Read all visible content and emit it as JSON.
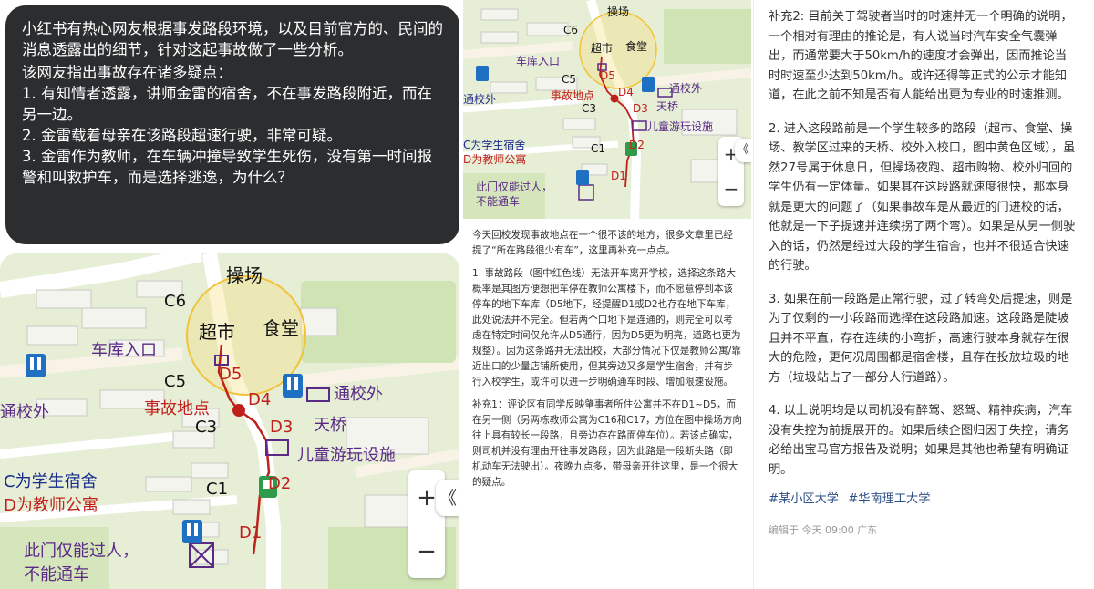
{
  "bubble": {
    "para1": "小红书有热心网友根据事发路段环境，以及目前官方的、民间的消息透露出的细节，针对这起事故做了一些分析。",
    "para2": "该网友指出事故存在诸多疑点：",
    "item1": "1. 有知情者透露，讲师金雷的宿舍，不在事发路段附近，而在另一边。",
    "item2": "2. 金雷载着母亲在该路段超速行驶，非常可疑。",
    "item3": "3. 金雷作为教师，在车辆冲撞导致学生死伤，没有第一时间报警和叫救护车，而是选择逃逸，为什么？"
  },
  "map": {
    "playground": "操场",
    "c6": "C6",
    "supermarket": "超市",
    "canteen": "食堂",
    "garage_entrance": "车库入口",
    "d5": "D5",
    "to_outside_left": "通校外",
    "c5": "C5",
    "accident_site": "事故地点",
    "d4": "D4",
    "to_outside_right": "通校外",
    "overpass": "天桥",
    "c3": "C3",
    "d3": "D3",
    "playground_facility": "儿童游玩设施",
    "legend_c": "C为学生宿舍",
    "legend_d": "D为教师公寓",
    "c1": "C1",
    "d2": "D2",
    "d1": "D1",
    "gate_note_line1": "此门仅能过人，",
    "gate_note_line2": "不能通车",
    "zoom_in": "+",
    "zoom_out": "−",
    "expand": "《",
    "colors": {
      "route": "#c0201b",
      "circle": "#f1c33a",
      "blue_sign": "#1f6fc2",
      "green_sign": "#2f9a4a"
    }
  },
  "middle": {
    "intro": "今天回校发现事故地点在一个很不该的地方，很多文章里已经提了“所在路段很少有车”，这里再补充一点点。",
    "p1": "1. 事故路段（图中红色线）无法开车离开学校，选择这条路大概率是其图方便想把车停在教师公寓楼下，而不愿意停到本该停车的地下车库（D5地下，经提醒D1或D2也存在地下车库，此处说法并不完全。但若两个口地下是连通的，则完全可以考虑在特定时间仅允许从D5通行，因为D5更为明亮，道路也更为规整）。因为这条路并无法出校，大部分情况下仅是教师公寓/靠近出口的少量店铺所使用，但其旁边又多是学生宿舍，并有步行入校学生，或许可以进一步明确通车时段、增加限速设施。",
    "p2": "补充1：评论区有同学反映肇事者所住公寓并不在D1~D5，而在另一侧（另两栋教师公寓为C16和C17，方位在图中操场方向往上具有较长一段路，且旁边存在路面停车位）。若该点确实，则司机并没有理由开往事发路段，因为此路是一段断头路（即机动车无法驶出）。夜晚九点多，带母亲开往这里，是一个很大的疑点。"
  },
  "right": {
    "p1": "补充2: 目前关于驾驶者当时的时速并无一个明确的说明，一个相对有理由的推论是，有人说当时汽车安全气囊弹出，而通常要大于50km/h的速度才会弹出，因而推论当时时速至少达到50km/h。或许还得等正式的公示才能知道，在此之前不知是否有人能给出更为专业的时速推测。",
    "p2": "2. 进入这段路前是一个学生较多的路段（超市、食堂、操场、教学区过来的天桥、校外入校口，图中黄色区域），虽然27号属于休息日，但操场夜跑、超市购物、校外归回的学生仍有一定体量。如果其在这段路就速度很快，那本身就是更大的问题了（如果事故车是从最近的门进校的话，他就是一下子提速并连续拐了两个弯）。如果是从另一侧驶入的话，仍然是经过大段的学生宿舍，也并不很适合快速的行驶。",
    "p3": "3. 如果在前一段路是正常行驶，过了转弯处后提速，则是为了仅剩的一小段路而选择在这段路加速。这段路是陡坡且并不平直，存在连续的小弯折，高速行驶本身就存在很大的危险，更何况周围都是宿舍楼，且存在投放垃圾的地方（垃圾站占了一部分人行道路）。",
    "p4": "4. 以上说明均是以司机没有醉驾、怒驾、精神疾病，汽车没有失控为前提展开的。如果后续企图归因于失控，请务必给出宝马官方报告及说明；如果是其他也希望有明确证明。",
    "tag1": "#某小区大学",
    "tag2": "#华南理工大学",
    "meta": "编辑于 今天 09:00 广东"
  }
}
